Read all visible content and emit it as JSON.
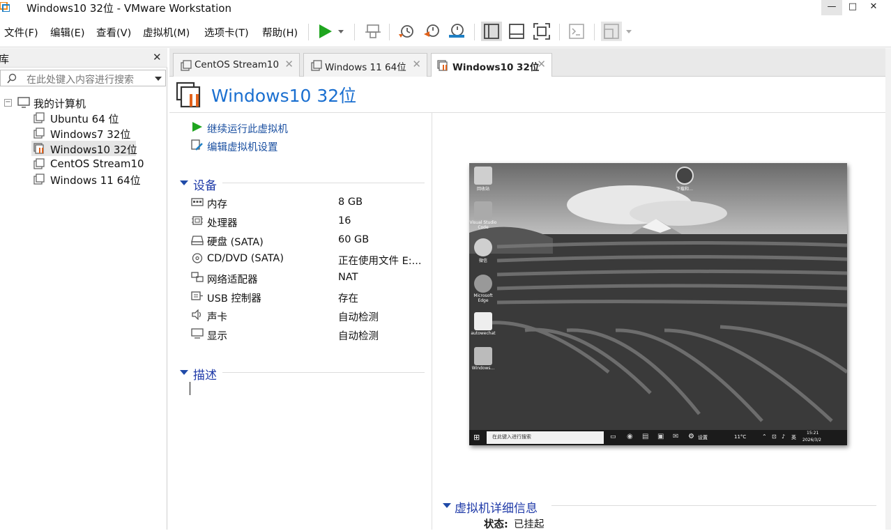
{
  "window": {
    "title": "Windows10 32位 - VMware Workstation",
    "minimize": "—",
    "maximize": "□",
    "close": "✕"
  },
  "menu": [
    "文件(F)",
    "编辑(E)",
    "查看(V)",
    "虚拟机(M)",
    "选项卡(T)",
    "帮助(H)"
  ],
  "toolbar": {
    "play": "power-on-icon",
    "play_dropdown": "chevron-down-icon",
    "send_keys": "send-ctrl-alt-del-icon",
    "snapshot_take": "snapshot-take-icon",
    "snapshot_revert": "snapshot-revert-icon",
    "snapshot_manager": "snapshot-manager-icon",
    "view_library": "show-library-icon",
    "view_thumbnail": "thumbnail-bar-icon",
    "view_fullscreen": "full-screen-icon",
    "console": "console-view-icon",
    "unity": "unity-view-icon",
    "play_color": "#1fa51f"
  },
  "library": {
    "title": "库",
    "close": "✕",
    "search_placeholder": "在此处键入内容进行搜索",
    "root": "我的计算机",
    "items": [
      {
        "label": "Ubuntu 64 位",
        "selected": false
      },
      {
        "label": "Windows7 32位",
        "selected": false
      },
      {
        "label": "Windows10 32位",
        "selected": true
      },
      {
        "label": "CentOS  Stream10",
        "selected": false
      },
      {
        "label": "Windows 11 64位",
        "selected": false
      }
    ]
  },
  "tabs": [
    {
      "label": "CentOS  Stream10",
      "active": false
    },
    {
      "label": "Windows 11 64位",
      "active": false
    },
    {
      "label": "Windows10 32位",
      "active": true
    }
  ],
  "vm": {
    "name": "Windows10 32位",
    "actions": {
      "resume": "继续运行此虚拟机",
      "edit": "编辑虚拟机设置"
    },
    "devices_title": "设备",
    "devices": [
      {
        "name": "内存",
        "value": "8 GB",
        "icon": "memory-icon"
      },
      {
        "name": "处理器",
        "value": "16",
        "icon": "processor-icon"
      },
      {
        "name": "硬盘 (SATA)",
        "value": "60 GB",
        "icon": "hard-disk-icon"
      },
      {
        "name": "CD/DVD (SATA)",
        "value": "正在使用文件 E:...",
        "icon": "cd-dvd-icon"
      },
      {
        "name": "网络适配器",
        "value": "NAT",
        "icon": "network-adapter-icon"
      },
      {
        "name": "USB 控制器",
        "value": "存在",
        "icon": "usb-controller-icon"
      },
      {
        "name": "声卡",
        "value": "自动检测",
        "icon": "sound-card-icon"
      },
      {
        "name": "显示",
        "value": "自动检测",
        "icon": "display-icon"
      }
    ],
    "description_title": "描述",
    "details_title": "虚拟机详细信息",
    "status_label": "状态:",
    "status_value": "已挂起",
    "accent": "#1f3aa8",
    "suspended_color": "#e2621b"
  },
  "guest": {
    "desktop_icons": [
      "回收站",
      "Visual Studio Code",
      "微信",
      "Microsoft Edge",
      "autowechat",
      "Windows..."
    ],
    "top_icon_label": "下载和…",
    "taskbar_search": "在此键入进行搜索",
    "settings": "设置",
    "weather": "11°C",
    "ime": "英",
    "time": "15:21",
    "date": "2026/3/2"
  }
}
